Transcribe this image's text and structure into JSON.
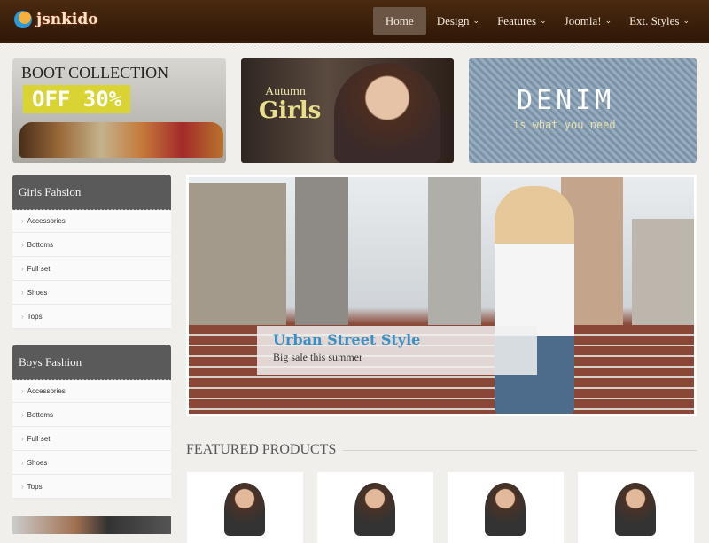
{
  "header": {
    "logo": "jsnkido",
    "nav": [
      {
        "label": "Home",
        "active": true
      },
      {
        "label": "Design",
        "dropdown": true
      },
      {
        "label": "Features",
        "dropdown": true
      },
      {
        "label": "Joomla!",
        "dropdown": true
      },
      {
        "label": "Ext. Styles",
        "dropdown": true
      }
    ]
  },
  "banners": [
    {
      "title": "BOOT COLLECTION",
      "subtitle": "OFF 30%"
    },
    {
      "title": "Autumn",
      "subtitle": "Girls"
    },
    {
      "title": "DENIM",
      "subtitle": "is what you need"
    }
  ],
  "sidebar": [
    {
      "title": "Girls Fahsion",
      "items": [
        "Accessories",
        "Bottoms",
        "Full set",
        "Shoes",
        "Tops"
      ]
    },
    {
      "title": "Boys Fashion",
      "items": [
        "Accessories",
        "Bottoms",
        "Full set",
        "Shoes",
        "Tops"
      ]
    }
  ],
  "hero": {
    "title": "Urban Street Style",
    "subtitle": "Big sale this summer"
  },
  "featured": {
    "title": "FEATURED PRODUCTS"
  }
}
